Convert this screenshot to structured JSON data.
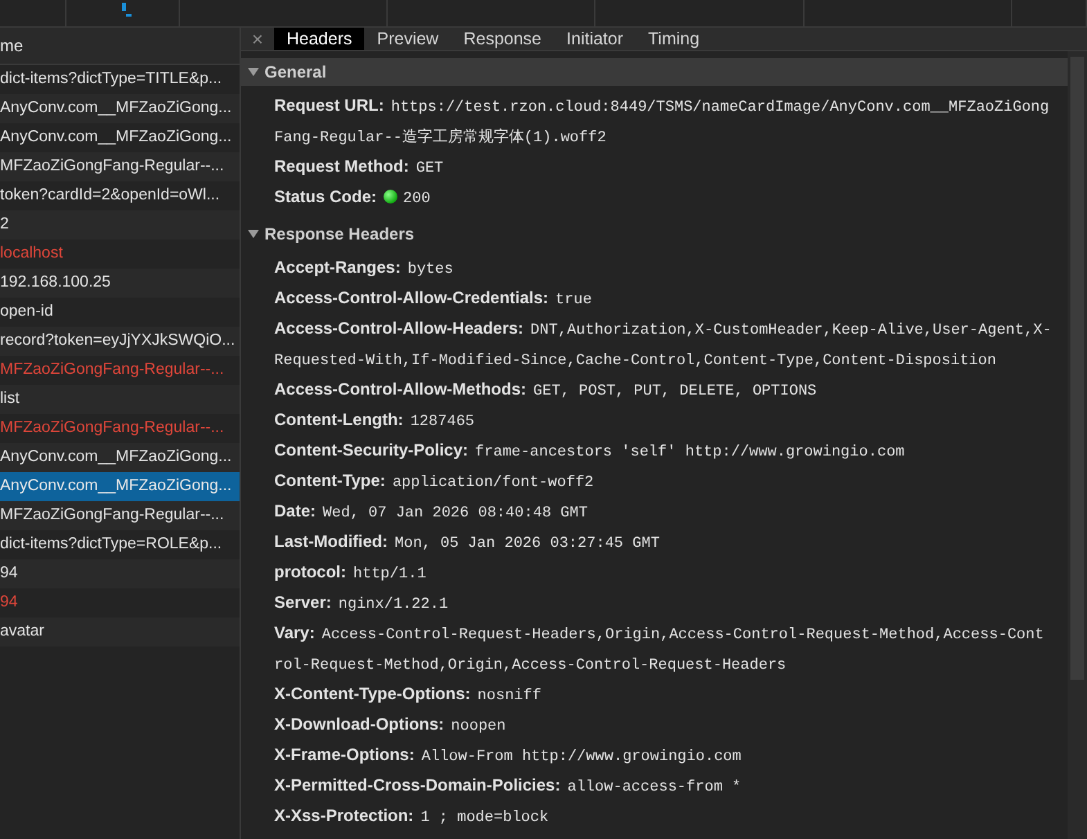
{
  "requests": {
    "column_header": "me",
    "rows": [
      {
        "name": "dict-items?dictType=TITLE&p...",
        "failed": false,
        "selected": false
      },
      {
        "name": "AnyConv.com__MFZaoZiGong...",
        "failed": false,
        "selected": false
      },
      {
        "name": "AnyConv.com__MFZaoZiGong...",
        "failed": false,
        "selected": false
      },
      {
        "name": "MFZaoZiGongFang-Regular--...",
        "failed": false,
        "selected": false
      },
      {
        "name": "token?cardId=2&openId=oWl...",
        "failed": false,
        "selected": false
      },
      {
        "name": "2",
        "failed": false,
        "selected": false
      },
      {
        "name": "localhost",
        "failed": true,
        "selected": false
      },
      {
        "name": "192.168.100.25",
        "failed": false,
        "selected": false
      },
      {
        "name": "open-id",
        "failed": false,
        "selected": false
      },
      {
        "name": "record?token=eyJjYXJkSWQiO...",
        "failed": false,
        "selected": false
      },
      {
        "name": "MFZaoZiGongFang-Regular--...",
        "failed": true,
        "selected": false
      },
      {
        "name": "list",
        "failed": false,
        "selected": false
      },
      {
        "name": "MFZaoZiGongFang-Regular--...",
        "failed": true,
        "selected": false
      },
      {
        "name": "AnyConv.com__MFZaoZiGong...",
        "failed": false,
        "selected": false
      },
      {
        "name": "AnyConv.com__MFZaoZiGong...",
        "failed": false,
        "selected": true
      },
      {
        "name": "MFZaoZiGongFang-Regular--...",
        "failed": false,
        "selected": false
      },
      {
        "name": "dict-items?dictType=ROLE&p...",
        "failed": false,
        "selected": false
      },
      {
        "name": "94",
        "failed": false,
        "selected": false
      },
      {
        "name": "94",
        "failed": true,
        "selected": false
      },
      {
        "name": "avatar",
        "failed": false,
        "selected": false
      }
    ]
  },
  "detail": {
    "close": "×",
    "tabs": [
      {
        "label": "Headers",
        "selected": true
      },
      {
        "label": "Preview",
        "selected": false
      },
      {
        "label": "Response",
        "selected": false
      },
      {
        "label": "Initiator",
        "selected": false
      },
      {
        "label": "Timing",
        "selected": false
      }
    ],
    "sections": [
      {
        "title": "General",
        "expanded": true,
        "rows": [
          {
            "key": "Request URL:",
            "value": "https://test.rzon.cloud:8449/TSMS/nameCardImage/AnyConv.com__MFZaoZiGongFang-Regular--造字工房常规字体(1).woff2"
          },
          {
            "key": "Request Method:",
            "value": "GET"
          },
          {
            "key": "Status Code:",
            "value": "200",
            "kind": "status"
          }
        ]
      },
      {
        "title": "Response Headers",
        "expanded": true,
        "rows": [
          {
            "key": "Accept-Ranges:",
            "value": "bytes"
          },
          {
            "key": "Access-Control-Allow-Credentials:",
            "value": "true"
          },
          {
            "key": "Access-Control-Allow-Headers:",
            "value": "DNT,Authorization,X-CustomHeader,Keep-Alive,User-Agent,X-Requested-With,If-Modified-Since,Cache-Control,Content-Type,Content-Disposition"
          },
          {
            "key": "Access-Control-Allow-Methods:",
            "value": "GET, POST, PUT, DELETE, OPTIONS"
          },
          {
            "key": "Content-Length:",
            "value": "1287465"
          },
          {
            "key": "Content-Security-Policy:",
            "value": "frame-ancestors 'self' http://www.growingio.com"
          },
          {
            "key": "Content-Type:",
            "value": "application/font-woff2"
          },
          {
            "key": "Date:",
            "value": "Wed, 07 Jan 2026 08:40:48 GMT"
          },
          {
            "key": "Last-Modified:",
            "value": "Mon, 05 Jan 2026 03:27:45 GMT"
          },
          {
            "key": "protocol:",
            "value": "http/1.1"
          },
          {
            "key": "Server:",
            "value": "nginx/1.22.1"
          },
          {
            "key": "Vary:",
            "value": "Access-Control-Request-Headers,Origin,Access-Control-Request-Method,Access-Control-Request-Method,Origin,Access-Control-Request-Headers"
          },
          {
            "key": "X-Content-Type-Options:",
            "value": "nosniff"
          },
          {
            "key": "X-Download-Options:",
            "value": "noopen"
          },
          {
            "key": "X-Frame-Options:",
            "value": "Allow-From http://www.growingio.com"
          },
          {
            "key": "X-Permitted-Cross-Domain-Policies:",
            "value": "allow-access-from *"
          },
          {
            "key": "X-Xss-Protection:",
            "value": "1 ; mode=block"
          }
        ]
      }
    ]
  }
}
